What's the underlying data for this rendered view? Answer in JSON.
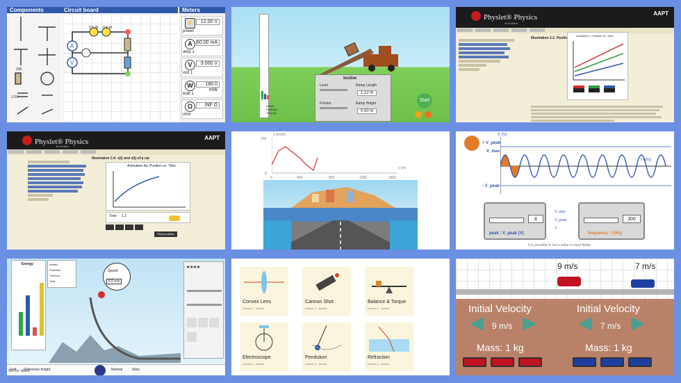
{
  "tile1": {
    "components_header": "Components",
    "circuit_header": "Circuit board",
    "meters_header": "Meters",
    "meters": [
      {
        "icon": "power-icon",
        "symbol": "",
        "label": "power",
        "value": "12.00 V"
      },
      {
        "icon": "ammeter-icon",
        "symbol": "A",
        "label": "amp 1",
        "value": "60.00 mA"
      },
      {
        "icon": "voltmeter-icon",
        "symbol": "V",
        "label": "volt 1",
        "value": "9.000 V"
      },
      {
        "icon": "wattmeter-icon",
        "symbol": "W",
        "label": "watt 1",
        "value": "180.0 mW"
      },
      {
        "icon": "ohmmeter-icon",
        "symbol": "Ω",
        "label": "ohm",
        "value": "INF Ω"
      }
    ],
    "bulb_labels": [
      "0.5 W",
      "0.5 W"
    ],
    "resistor_label": "100",
    "switch_label": "1.5V"
  },
  "tile2": {
    "incline_label": "Incline",
    "start_label": "Start",
    "sliders": [
      "Level",
      "Ramp Length",
      "Friction",
      "Ramp Height"
    ],
    "values": [
      "1.12 m",
      "0.50 m"
    ],
    "side_labels": [
      "Kinetic",
      "Potential",
      "Thermal"
    ]
  },
  "tile3": {
    "brand": "Physlet® Physics",
    "edition": "3rd Edition",
    "aapt": "AAPT",
    "section_title": "Illustration 2.1: Position vs. Time",
    "chart_title": "Animation 1: Position vs. Time"
  },
  "tile4": {
    "brand": "Physlet® Physics",
    "edition": "3rd Edition",
    "aapt": "AAPT",
    "section_title": "Illustration 2.4: x(t) and v(t) of a car",
    "chart_title": "Animation 4a: Position vs. Time",
    "time_label": "Time",
    "time_value": "1.2",
    "button_label": "Show position"
  },
  "tile5": {
    "y_label": "v (km/h)",
    "x_label": "x (m)",
    "y_ticks": [
      "100",
      "80",
      "60",
      "40",
      "20",
      "0"
    ],
    "x_ticks": [
      "0",
      "400",
      "800",
      "1200",
      "1600"
    ]
  },
  "tile6": {
    "y_label": "V (V)",
    "x_label": "t (ms)",
    "vpeak_top": "+ V_peak",
    "vpeak_bot": "- V_peak",
    "vmax": "V_max",
    "peak_label": "peak : V_peak (V)",
    "peak_value": "8",
    "freq_label": "frequency : f (Hz)",
    "freq_value": "300",
    "note": "It is possible to set a value in input fields.",
    "check_labels": [
      "V_max:",
      "V_peak:",
      "T:"
    ]
  },
  "tile7": {
    "energy_header": "Energy",
    "legend": [
      "Kinetic",
      "Potential",
      "Thermal",
      "Total"
    ],
    "speed_label": "Speed",
    "speed_value": "6.0 m/s",
    "footer_left": "Sim for skiers",
    "checkbox_labels": [
      "Grid",
      "Reference height"
    ],
    "playback": [
      "Normal",
      "Slow"
    ]
  },
  "tile8": {
    "sims": [
      {
        "title": "Convex Lens",
        "sub": "Lesson 1 · Author"
      },
      {
        "title": "Cannon Shot",
        "sub": "Lesson 1 · Author"
      },
      {
        "title": "Balance & Torque",
        "sub": "Lesson 1 · Author"
      },
      {
        "title": "Electroscope",
        "sub": "Lesson 1 · Author"
      },
      {
        "title": "Pendulum",
        "sub": "Lesson 1 · Author"
      },
      {
        "title": "Refraction",
        "sub": "Lesson 1 · Author"
      }
    ]
  },
  "tile9": {
    "speed_left": "9 m/s",
    "speed_right": "7 m/s",
    "label_left": "Initial Velocity",
    "label_right": "Initial Velocity",
    "value_left": "9 m/s",
    "value_right": "7 m/s",
    "mass_left": "Mass: 1 kg",
    "mass_right": "Mass: 1 kg",
    "colors": {
      "red": "#c1121f",
      "blue": "#1d3fa0",
      "panel": "#b98268"
    }
  }
}
